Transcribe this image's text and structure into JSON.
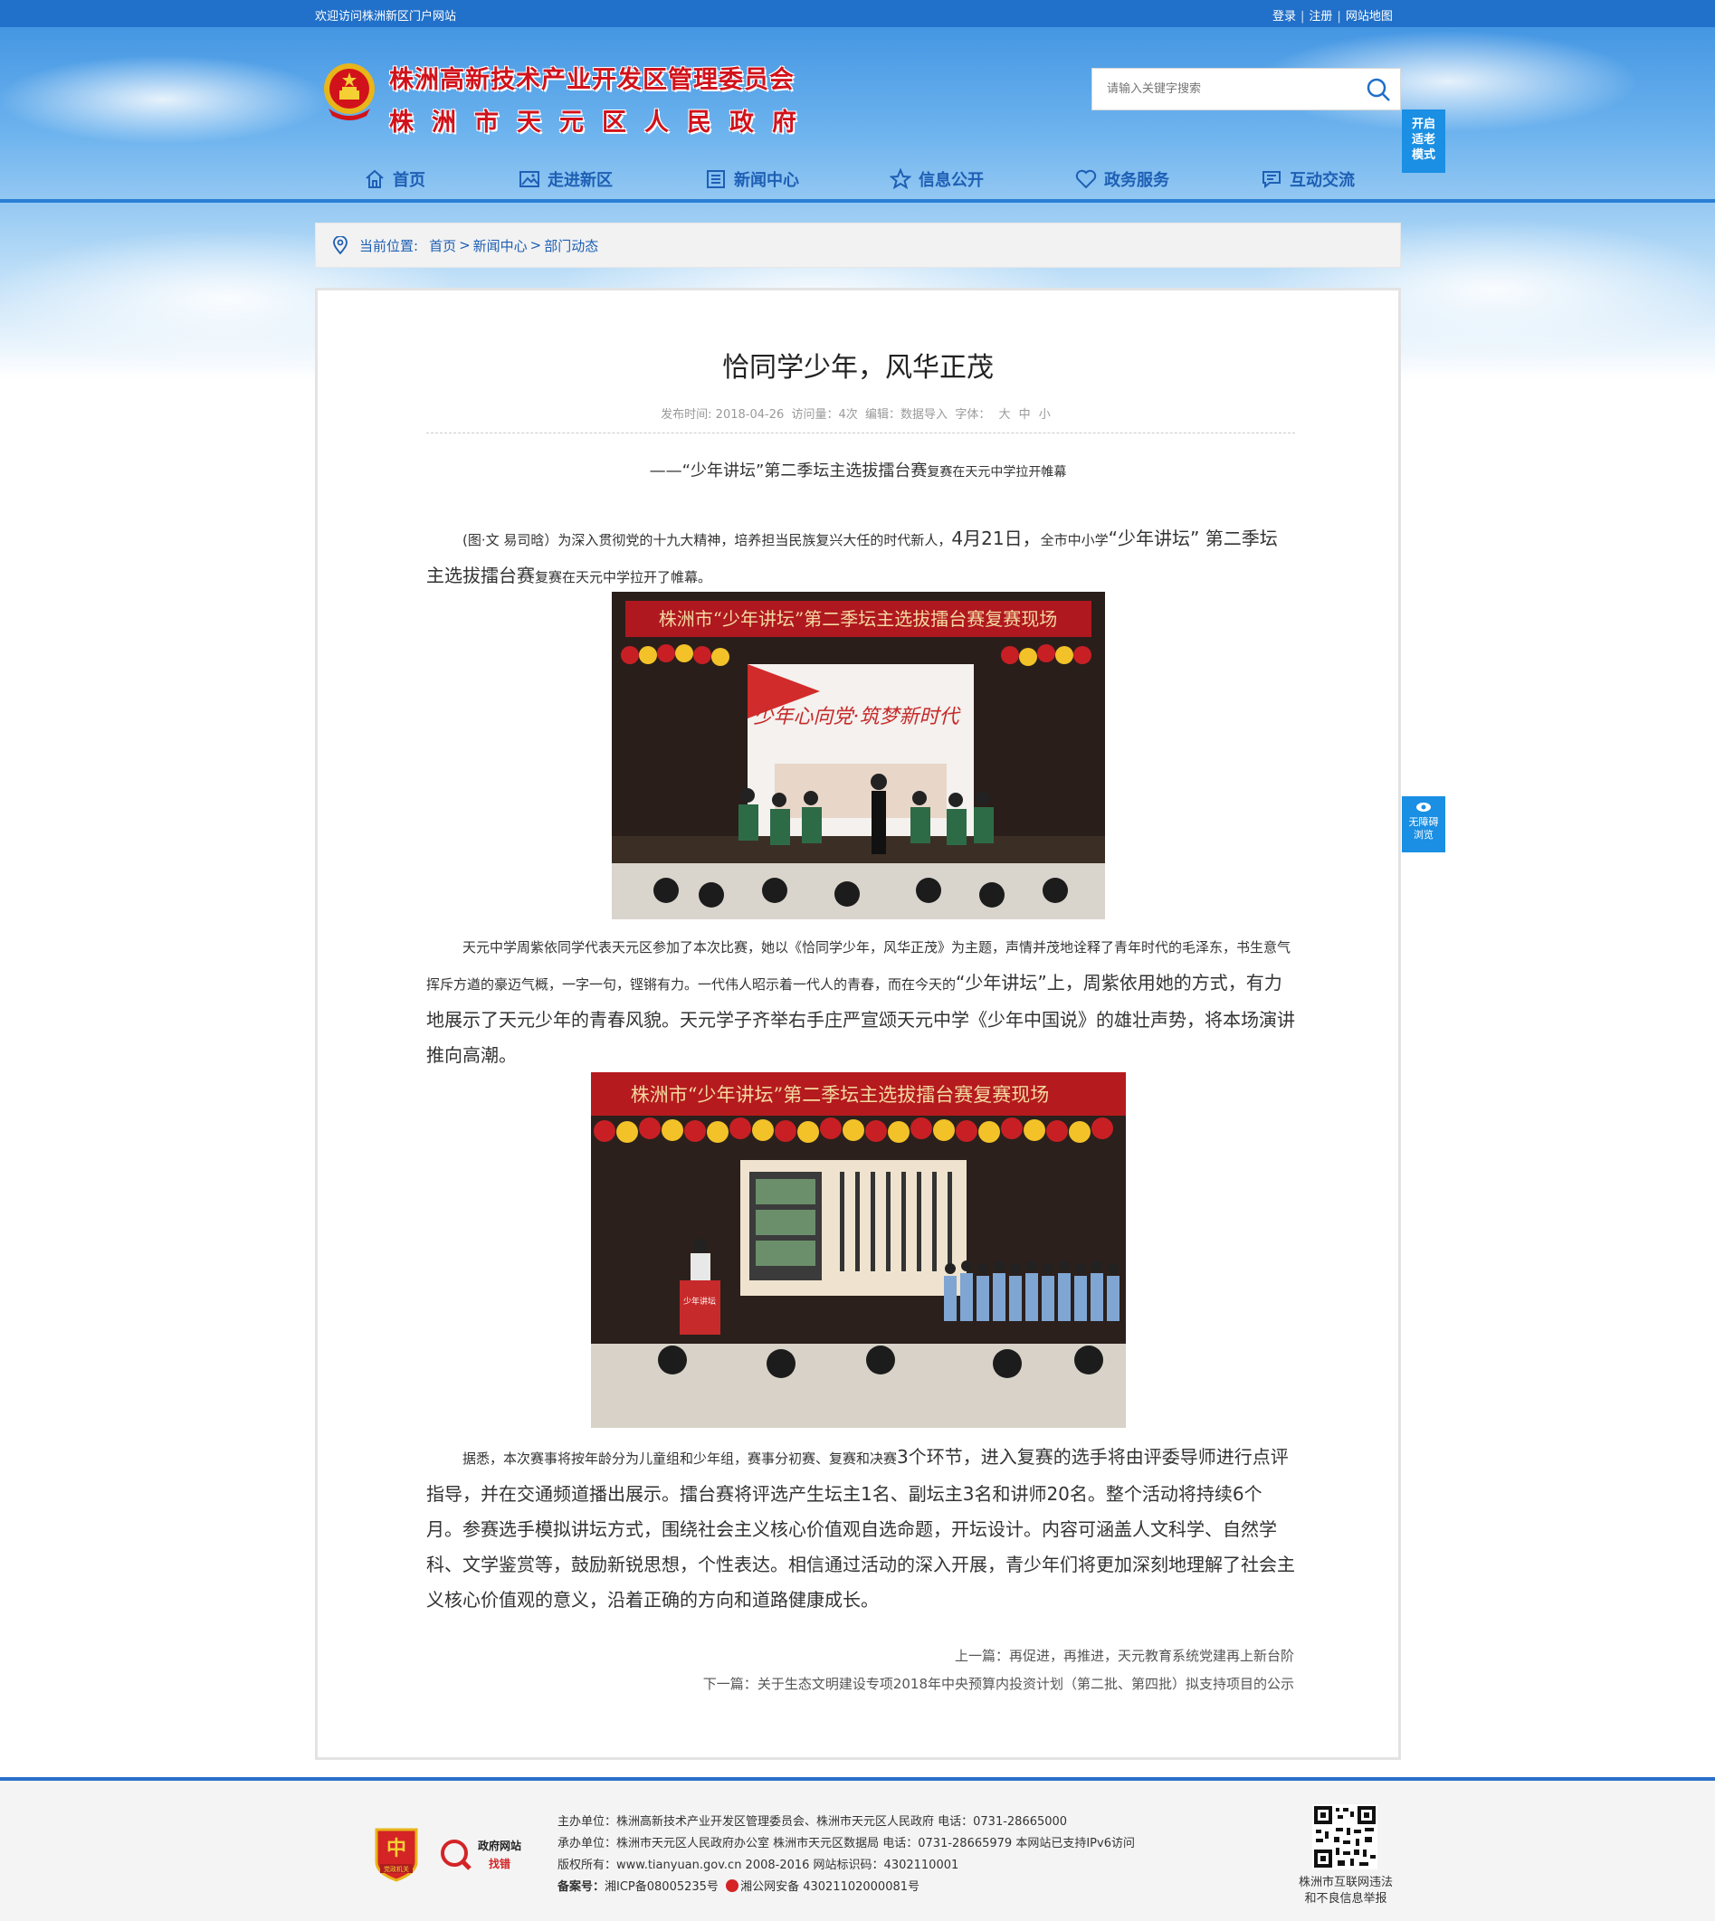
{
  "topbar": {
    "welcome": "欢迎访问株洲新区门户网站",
    "login": "登录",
    "register": "注册",
    "sitemap": "网站地图"
  },
  "header": {
    "title_line1": "株洲高新技术产业开发区管理委员会",
    "title_line2": "株洲市天元区人民政府",
    "search_placeholder": "请输入关键字搜索",
    "elder_mode": [
      "开启",
      "适老",
      "模式"
    ]
  },
  "nav": {
    "items": [
      {
        "label": "首页",
        "icon": "home-icon"
      },
      {
        "label": "走进新区",
        "icon": "picture-icon"
      },
      {
        "label": "新闻中心",
        "icon": "newspaper-icon"
      },
      {
        "label": "信息公开",
        "icon": "star-icon"
      },
      {
        "label": "政务服务",
        "icon": "heart-icon"
      },
      {
        "label": "互动交流",
        "icon": "chat-icon"
      }
    ]
  },
  "breadcrumb": {
    "label": "当前位置:",
    "items": [
      "首页",
      "新闻中心",
      "部门动态"
    ],
    "sep": ">"
  },
  "article": {
    "title": "恰同学少年，风华正茂",
    "meta_date": "发布时间:  2018-04-26",
    "meta_views": "访问量：4次",
    "meta_editor": "编辑：数据导入",
    "meta_font_label": "字体：",
    "meta_font_sizes": [
      "大",
      "中",
      "小"
    ],
    "subtitle_main": "——“少年讲坛”第二季坛主选拔擂台赛",
    "subtitle_small": "复赛在天元中学拉开帷幕",
    "p1_small": "(图·文  易司晗）为深入贯彻党的十九大精神，培养担当民族复兴大任的时代新人，",
    "p1_date": "4月21日，",
    "p1_small2": "全市中小学",
    "p1_rest": "“少年讲坛” 第二季坛主选拔擂台赛",
    "p1_small3": "复赛在天元中学拉开了帷幕。",
    "photo1_banner": "株洲市“少年讲坛”第二季坛主选拔擂台赛复赛现场",
    "photo1_screen": "少年心向党·筑梦新时代",
    "p2_small": "天元中学周紫依同学代表天元区参加了本次比赛，她以《恰同学少年，风华正茂》为主题，声情并茂地诠释了青年时代的毛泽东，书生意气挥斥方遒的豪迈气概，一字一句，铿锵有力。一代伟人昭示着一代人的青春，而在今天的",
    "p2_rest": "“少年讲坛”上，周紫依用她的方式，有力地展示了天元少年的青春风貌。天元学子齐举右手庄严宣颂天元中学《少年中国说》的雄壮声势，将本场演讲推向高潮。",
    "photo2_banner": "株洲市“少年讲坛”第二季坛主选拔擂台赛复赛现场",
    "photo2_podium": "少年讲坛",
    "p3_small": "据悉，本次赛事将按年龄分为儿童组和少年组，赛事分初赛、复赛和决赛",
    "p3_rest": "3个环节，进入复赛的选手将由评委导师进行点评指导，并在交通频道播出展示。擂台赛将评选产生坛主1名、副坛主3名和讲师20名。整个活动将持续6个月。参赛选手模拟讲坛方式，围绕社会主义核心价值观自选命题，开坛设计。内容可涵盖人文科学、自然学科、文学鉴赏等，鼓励新锐思想，个性表达。相信通过活动的深入开展，青少年们将更加深刻地理解了社会主义核心价值观的意义，沿着正确的方向和道路健康成长。",
    "prev_label": "上一篇：",
    "prev_title": "再促进，再推进，天元教育系统党建再上新台阶",
    "next_label": "下一篇：",
    "next_title": "关于生态文明建设专项2018年中央预算内投资计划（第二批、第四批）拟支持项目的公示"
  },
  "accessibility": {
    "label1": "无障碍",
    "label2": "浏览"
  },
  "footer": {
    "party_badge_text": "党政机关",
    "gov_site_label": "政府网站",
    "gov_site_error": "找错",
    "line1": "主办单位：株洲高新技术产业开发区管理委员会、株洲市天元区人民政府  电话：0731-28665000",
    "line2": "承办单位：株洲市天元区人民政府办公室  株洲市天元区数据局  电话：0731-28665979  本网站已支持IPv6访问",
    "line3": "版权所有：www.tianyuan.gov.cn 2008-2016  网站标识码：4302110001",
    "line4_label": "备案号：",
    "line4_icp": "湘ICP备08005235号",
    "line4_police": "湘公网安备 43021102000081号",
    "qr_caption1": "株洲市互联网违法",
    "qr_caption2": "和不良信息举报"
  }
}
